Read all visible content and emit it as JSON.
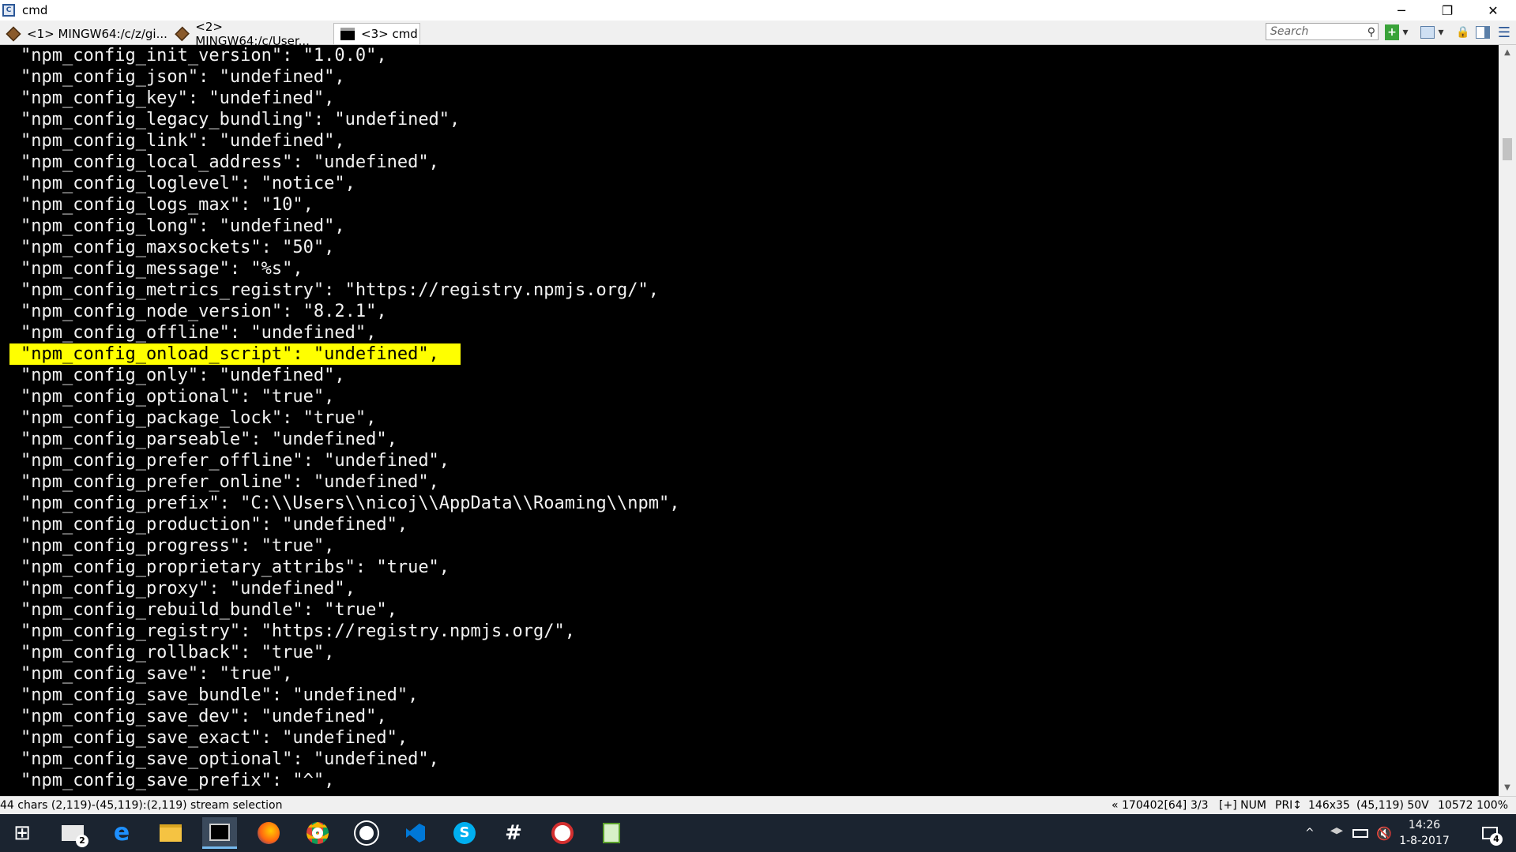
{
  "window": {
    "title": "cmd",
    "app_icon_letter": "C",
    "minimize_glyph": "─",
    "restore_glyph": "❐",
    "close_glyph": "✕"
  },
  "tabs": [
    {
      "label": "<1> MINGW64:/c/z/gi..."
    },
    {
      "label": "<2> MINGW64:/c/User..."
    },
    {
      "label": "<3> cmd"
    }
  ],
  "toolbar": {
    "search_placeholder": "Search",
    "search_glyph": "⚲",
    "new_glyph": "+",
    "dropdown_glyph": "▾",
    "lock_glyph": "🔒",
    "menu_glyph": "☰"
  },
  "terminal_lines": [
    "\"npm_config_init_version\": \"1.0.0\",",
    "\"npm_config_json\": \"undefined\",",
    "\"npm_config_key\": \"undefined\",",
    "\"npm_config_legacy_bundling\": \"undefined\",",
    "\"npm_config_link\": \"undefined\",",
    "\"npm_config_local_address\": \"undefined\",",
    "\"npm_config_loglevel\": \"notice\",",
    "\"npm_config_logs_max\": \"10\",",
    "\"npm_config_long\": \"undefined\",",
    "\"npm_config_maxsockets\": \"50\",",
    "\"npm_config_message\": \"%s\",",
    "\"npm_config_metrics_registry\": \"https://registry.npmjs.org/\",",
    "\"npm_config_node_version\": \"8.2.1\",",
    "\"npm_config_offline\": \"undefined\",",
    "\"npm_config_onload_script\": \"undefined\",",
    "\"npm_config_only\": \"undefined\",",
    "\"npm_config_optional\": \"true\",",
    "\"npm_config_package_lock\": \"true\",",
    "\"npm_config_parseable\": \"undefined\",",
    "\"npm_config_prefer_offline\": \"undefined\",",
    "\"npm_config_prefer_online\": \"undefined\",",
    "\"npm_config_prefix\": \"C:\\\\Users\\\\nicoj\\\\AppData\\\\Roaming\\\\npm\",",
    "\"npm_config_production\": \"undefined\",",
    "\"npm_config_progress\": \"true\",",
    "\"npm_config_proprietary_attribs\": \"true\",",
    "\"npm_config_proxy\": \"undefined\",",
    "\"npm_config_rebuild_bundle\": \"true\",",
    "\"npm_config_registry\": \"https://registry.npmjs.org/\",",
    "\"npm_config_rollback\": \"true\",",
    "\"npm_config_save\": \"true\",",
    "\"npm_config_save_bundle\": \"undefined\",",
    "\"npm_config_save_dev\": \"undefined\",",
    "\"npm_config_save_exact\": \"undefined\",",
    "\"npm_config_save_optional\": \"undefined\",",
    "\"npm_config_save_prefix\": \"^\","
  ],
  "selected_line_index": 14,
  "scrollbar": {
    "up_glyph": "▲",
    "down_glyph": "▼"
  },
  "status": {
    "selection": "44 chars (2,119)-(45,119):(2,119) stream selection",
    "buffer": "« 170402[64]",
    "tab_count": "3/3",
    "keys": "[+] NUM",
    "priority": "PRI↕",
    "size": "146x35",
    "cursor": "(45,119) 50V",
    "zoom": "10572 100%"
  },
  "taskbar": {
    "start_glyph": "⊞",
    "mail_badge": "2",
    "tray_up_glyph": "^",
    "speaker_glyph": "🔇",
    "notification_badge": "4",
    "time": "14:26",
    "date": "1-8-2017"
  },
  "colors": {
    "selection": "#ffff00",
    "terminal_bg": "#000000",
    "terminal_fg": "#f2f2f2",
    "taskbar_bg": "#1b2430"
  }
}
